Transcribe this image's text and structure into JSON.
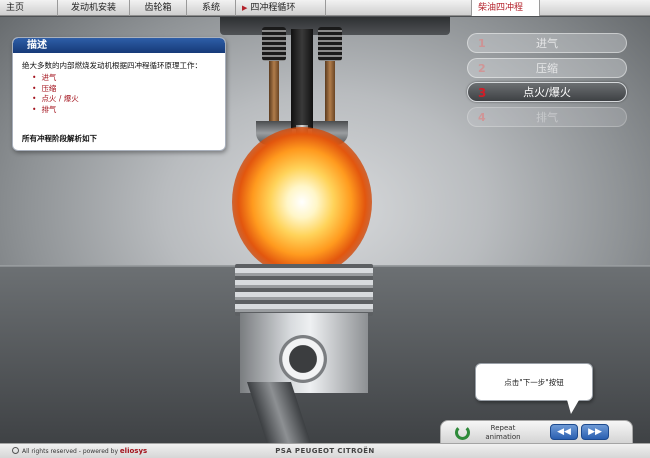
{
  "menu": {
    "home": "主页",
    "tabs": [
      "发动机安装",
      "齿轮箱",
      "系统"
    ],
    "current_path": "四冲程循环",
    "active_module": "柴油四冲程"
  },
  "description": {
    "title": "描述",
    "intro": "绝大多数的内部燃烧发动机根据四冲程循环原理工作：",
    "items": [
      "进气",
      "压缩",
      "点火 / 爆火",
      "排气"
    ],
    "footer": "所有冲程阶段解析如下"
  },
  "steps": [
    {
      "num": "1",
      "label": "进气",
      "state": "inactive"
    },
    {
      "num": "2",
      "label": "压缩",
      "state": "inactive"
    },
    {
      "num": "3",
      "label": "点火/爆火",
      "state": "active"
    },
    {
      "num": "4",
      "label": "排气",
      "state": "inactive"
    }
  ],
  "tooltip": "点击\"下一步\"按钮",
  "controls": {
    "repeat_line1": "Repeat",
    "repeat_line2": "animation",
    "prev_glyph": "◀◀",
    "next_glyph": "▶▶"
  },
  "footer": {
    "copyright": "All rights reserved  -  powered by",
    "logo": "eliosys",
    "brand": "PSA PEUGEOT CITROËN"
  },
  "colors": {
    "accent_red": "#b3202a",
    "panel_header_blue": "#1f4a92",
    "nav_blue": "#2a5fb0",
    "repeat_green": "#2e8a3a"
  }
}
